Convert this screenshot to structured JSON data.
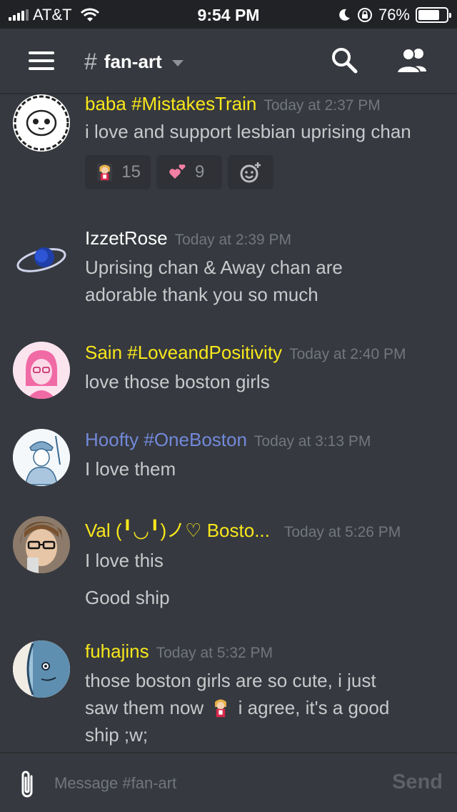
{
  "status_bar": {
    "carrier": "AT&T",
    "time": "9:54 PM",
    "battery": "76%",
    "battery_level": 0.76
  },
  "header": {
    "channel_hash": "#",
    "channel_name": "fan-art"
  },
  "messages": [
    {
      "username": "baba #MistakesTrain",
      "username_color": "#f8e71c",
      "timestamp": "Today at 2:37 PM",
      "lines": [
        "i love and support lesbian uprising chan"
      ],
      "reactions": [
        {
          "emoji": "mascot-emoji",
          "count": "15"
        },
        {
          "emoji": "hearts-emoji",
          "count": "9"
        }
      ]
    },
    {
      "username": "IzzetRose",
      "username_color": "#ffffff",
      "timestamp": "Today at 2:39 PM",
      "lines": [
        "Uprising chan & Away chan are",
        "adorable thank you so much"
      ]
    },
    {
      "username": "Sain #LoveandPositivity",
      "username_color": "#f8e71c",
      "timestamp": "Today at 2:40 PM",
      "lines": [
        "love those boston girls"
      ]
    },
    {
      "username": "Hoofty #OneBoston",
      "username_color": "#7289da",
      "timestamp": "Today at 3:13 PM",
      "lines": [
        "I love them"
      ]
    },
    {
      "username": "Val (╹◡╹)ノ♡ Bosto...",
      "username_color": "#f8e71c",
      "timestamp": "Today at 5:26 PM",
      "lines": [
        "I love this",
        "Good ship"
      ]
    },
    {
      "username": "fuhajins",
      "username_color": "#f8e71c",
      "timestamp": "Today at 5:32 PM",
      "line1": "those boston girls are so cute, i just",
      "line2_before": "saw them now",
      "line2_after": "i agree, it's a good",
      "line3": "ship ;w;"
    }
  ],
  "input": {
    "placeholder": "Message #fan-art",
    "send_label": "Send"
  }
}
